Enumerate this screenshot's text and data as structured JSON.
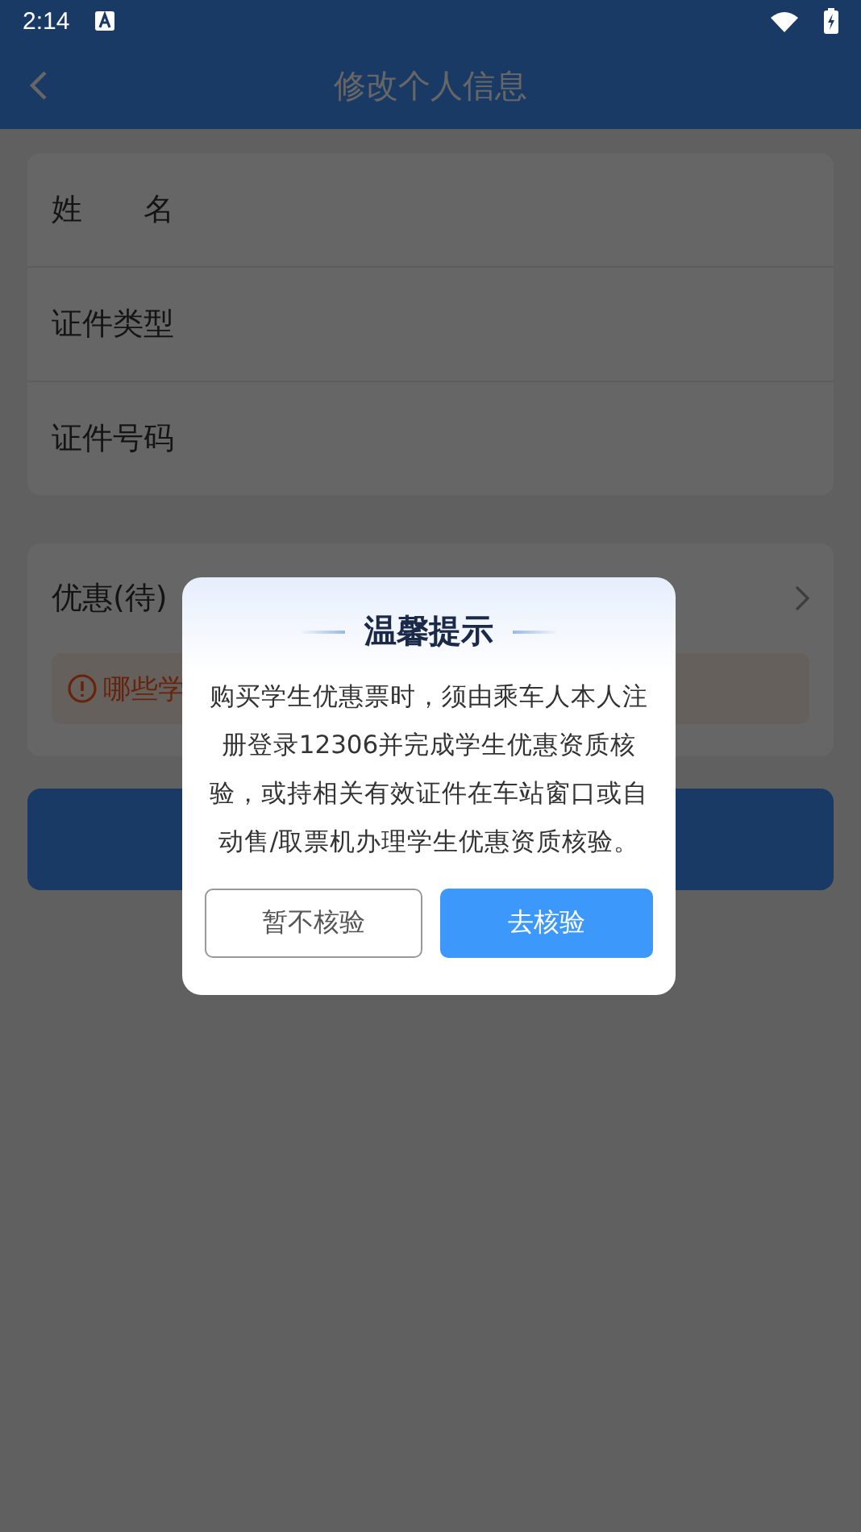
{
  "status_bar": {
    "time": "2:14"
  },
  "header": {
    "title": "修改个人信息"
  },
  "info_fields": [
    {
      "label": "姓　　名"
    },
    {
      "label": "证件类型"
    },
    {
      "label": "证件号码"
    }
  ],
  "discount": {
    "label": "优惠(待)",
    "notice": "哪些学"
  },
  "dialog": {
    "title": "温馨提示",
    "message": "购买学生优惠票时，须由乘车人本人注册登录12306并完成学生优惠资质核验，或持相关有效证件在车站窗口或自动售/取票机办理学生优惠资质核验。",
    "buttons": [
      {
        "label": "暂不核验",
        "kind": "secondary"
      },
      {
        "label": "去核验",
        "kind": "primary"
      }
    ]
  }
}
